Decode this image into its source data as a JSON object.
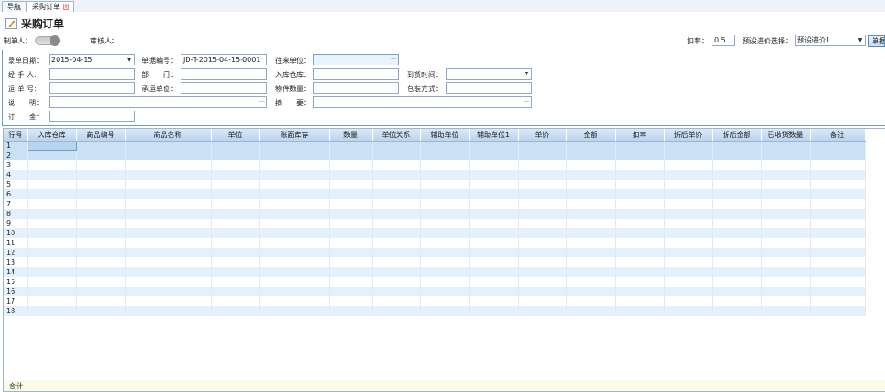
{
  "tabs": [
    {
      "label": "导航",
      "active": false
    },
    {
      "label": "采购订单",
      "active": true
    }
  ],
  "page_title": "采购订单",
  "meta": {
    "creator_label": "制单人：",
    "reviewer_label": "审核人：",
    "discount_label": "扣率：",
    "discount_value": "0.5",
    "preset_price_label": "预设进价选择：",
    "preset_price_value": "预设进价1",
    "unit_button_label": "单据"
  },
  "form": {
    "entry_date_label": "录单日期：",
    "entry_date_value": "2015-04-15",
    "doc_no_label": "单据编号：",
    "doc_no_value": "JD-T-2015-04-15-0001",
    "partner_label": "往来单位：",
    "partner_value": "",
    "handler_label": "经 手 人：",
    "department_label": "部　　门：",
    "warehouse_label": "入库仓库：",
    "arrival_time_label": "到货时间：",
    "waybill_label": "运 单 号：",
    "carrier_label": "承运单位：",
    "item_count_label": "物件数量：",
    "packing_label": "包装方式：",
    "note_label": "说　　明：",
    "summary_label": "摘　　要：",
    "deposit_label": "订　　金："
  },
  "grid": {
    "columns": [
      "行号",
      "入库仓库",
      "商品编号",
      "商品名称",
      "单位",
      "账面库存",
      "数量",
      "单位关系",
      "辅助单位",
      "辅助单位1",
      "单价",
      "金额",
      "扣率",
      "折后单价",
      "折后金额",
      "已收货数量",
      "备注"
    ],
    "rows": [
      "1",
      "2",
      "3",
      "4",
      "5",
      "6",
      "7",
      "8",
      "9",
      "10",
      "11",
      "12",
      "13",
      "14",
      "15",
      "16",
      "17",
      "18"
    ],
    "footer_label": "合计"
  },
  "colors": {
    "accent": "#6a9bd1",
    "header_bg": "#c9dcf1",
    "row_alt": "#e4f0fb",
    "footer_bg": "#fbfbe8"
  }
}
